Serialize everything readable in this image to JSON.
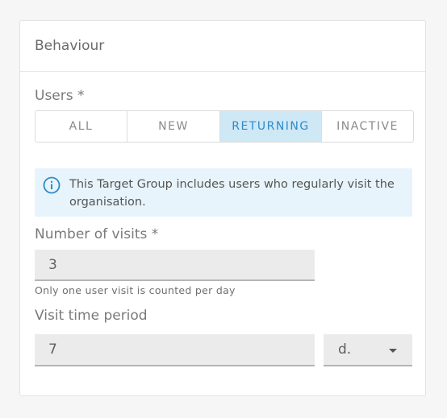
{
  "card": {
    "title": "Behaviour"
  },
  "users": {
    "label": "Users *",
    "options": [
      "ALL",
      "NEW",
      "RETURNING",
      "INACTIVE"
    ],
    "selected": "RETURNING"
  },
  "info": {
    "text": "This Target Group includes users who regularly visit the organisation.",
    "icon": "info-icon",
    "accent": "#2e8bc7"
  },
  "visits": {
    "label": "Number of visits *",
    "value": "3",
    "hint": "Only one user visit is counted per day"
  },
  "period": {
    "label": "Visit time period",
    "value": "7",
    "unit": "d."
  }
}
